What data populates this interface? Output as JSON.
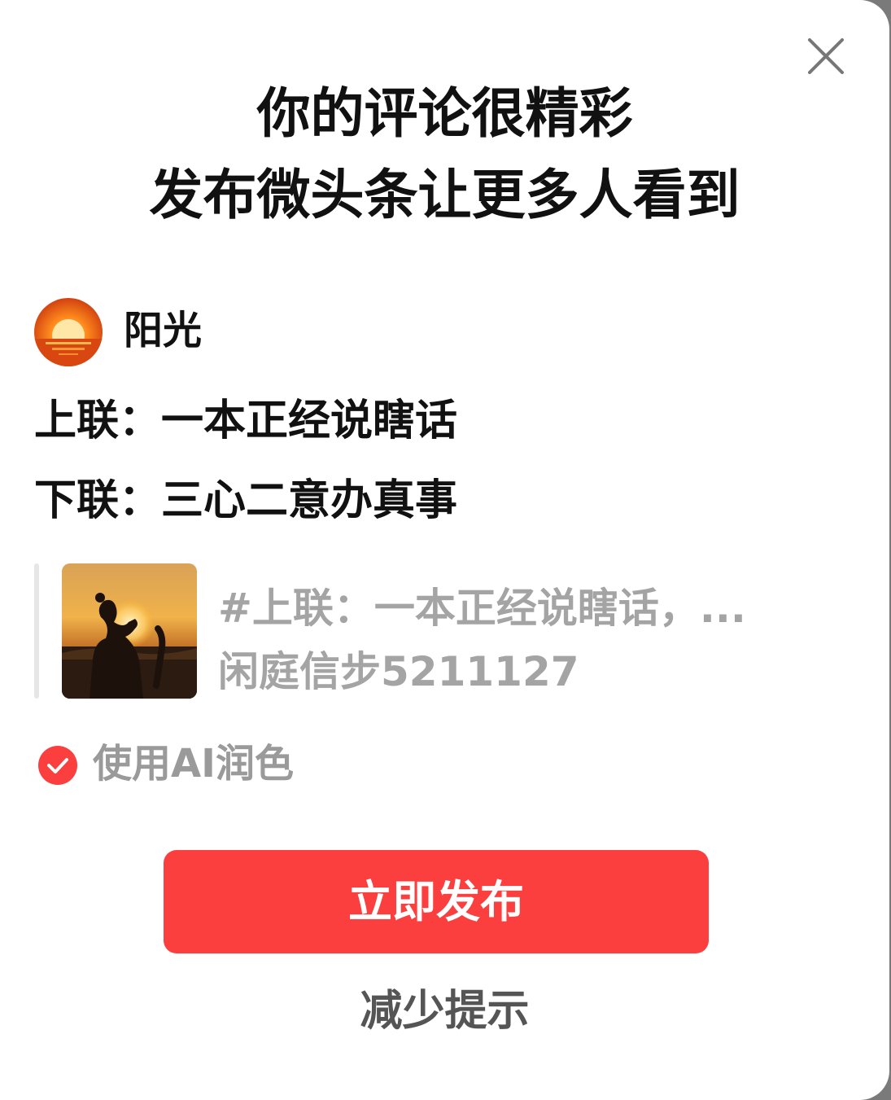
{
  "dialog": {
    "title_line1": "你的评论很精彩",
    "title_line2": "发布微头条让更多人看到"
  },
  "author": {
    "name": "阳光",
    "avatar_icon": "sunset-avatar"
  },
  "post": {
    "line1": "上联：一本正经说瞎话",
    "line2": "下联：三心二意办真事"
  },
  "quote": {
    "thumbnail_icon": "sunset-heart-photo",
    "title": "#上联：一本正经说瞎话，...",
    "author": "闲庭信步5211127"
  },
  "ai_option": {
    "label": "使用AI润色",
    "checked": true
  },
  "actions": {
    "publish_label": "立即发布",
    "reduce_label": "减少提示"
  },
  "colors": {
    "accent": "#fb3e3e",
    "muted_text": "#a4a4a4"
  }
}
